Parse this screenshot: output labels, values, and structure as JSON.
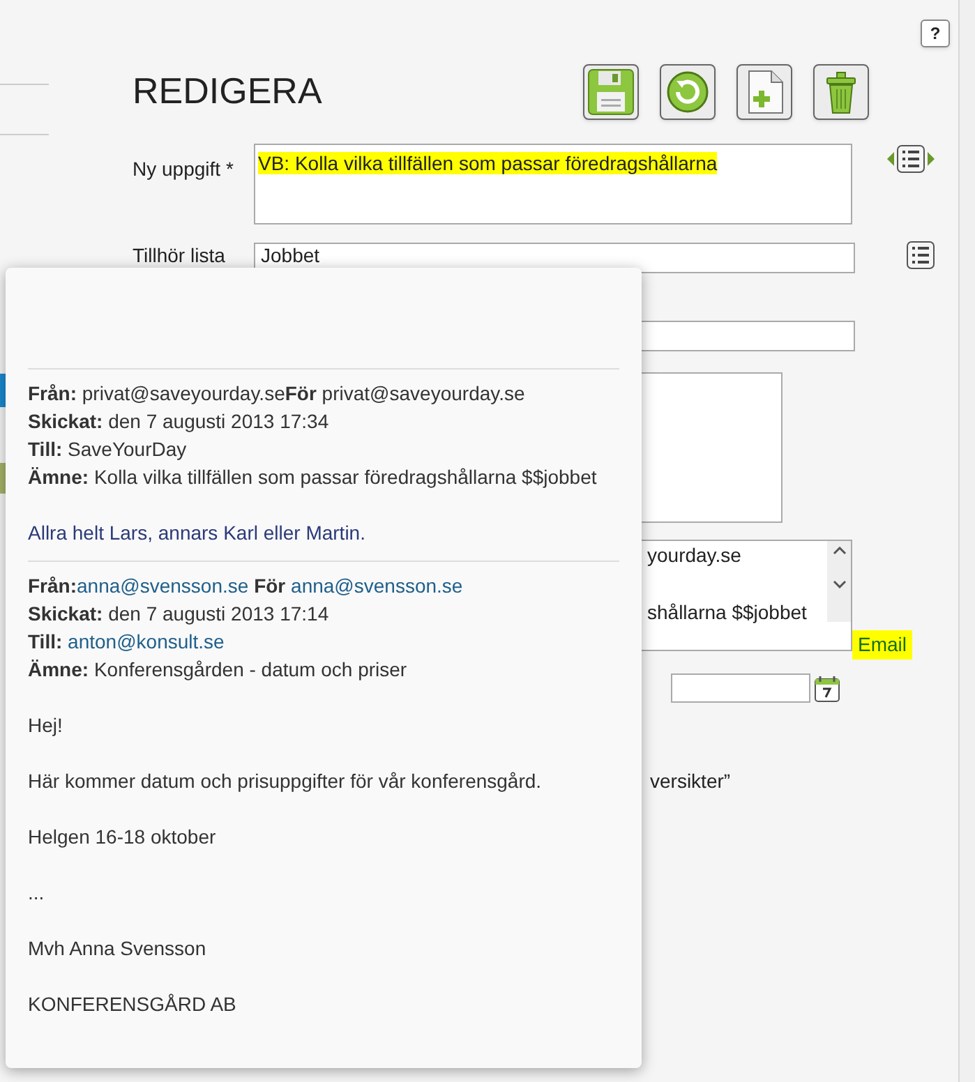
{
  "help_button": "?",
  "title": "REDIGERA",
  "toolbar": [
    {
      "kind": "save"
    },
    {
      "kind": "reset"
    },
    {
      "kind": "new"
    },
    {
      "kind": "delete"
    }
  ],
  "task": {
    "label": "Ny uppgift",
    "required_mark": "*",
    "value": "VB: Kolla vilka tillfällen som passar föredragshållarna",
    "highlighted": true
  },
  "list": {
    "label": "Tillhör lista",
    "value": "Jobbet"
  },
  "notes_preview": {
    "lines": [
      "yourday.se",
      "shållarna $$jobbet"
    ]
  },
  "email_link": {
    "text": "Email",
    "highlighted": true
  },
  "footer_text": "versikter”",
  "popup": {
    "messages": [
      {
        "headers": [
          [
            {
              "text": "Från:",
              "kind": "label"
            },
            {
              "text": " privat@saveyourday.se",
              "kind": "text"
            },
            {
              "text": "För",
              "kind": "label"
            },
            {
              "text": " privat@saveyourday.se",
              "kind": "text"
            }
          ],
          [
            {
              "text": "Skickat:",
              "kind": "label"
            },
            {
              "text": " den 7 augusti 2013 17:34",
              "kind": "text"
            }
          ],
          [
            {
              "text": "Till:",
              "kind": "label"
            },
            {
              "text": " SaveYourDay",
              "kind": "text"
            }
          ],
          [
            {
              "text": "Ämne:",
              "kind": "label"
            },
            {
              "text": " Kolla vilka tillfällen som passar föredragshållarna $$jobbet",
              "kind": "text"
            }
          ]
        ],
        "body": [
          {
            "text": "Allra helt Lars, annars Karl eller Martin.",
            "kind": "quote"
          }
        ]
      },
      {
        "headers": [
          [
            {
              "text": "Från:",
              "kind": "label"
            },
            {
              "text": "anna@svensson.se",
              "kind": "link"
            },
            {
              "text": " För ",
              "kind": "label"
            },
            {
              "text": "anna@svensson.se",
              "kind": "link"
            }
          ],
          [
            {
              "text": "Skickat:",
              "kind": "label"
            },
            {
              "text": " den 7 augusti 2013 17:14",
              "kind": "text"
            }
          ],
          [
            {
              "text": "Till: ",
              "kind": "label"
            },
            {
              "text": "anton@konsult.se",
              "kind": "link"
            }
          ],
          [
            {
              "text": "Ämne:",
              "kind": "label"
            },
            {
              "text": " Konferensgården - datum och priser",
              "kind": "text"
            }
          ]
        ],
        "body": [
          {
            "text": "Hej!",
            "kind": "text"
          },
          {
            "text": "Här kommer datum och prisuppgifter för vår konferensgård.",
            "kind": "text"
          },
          {
            "text": "Helgen 16-18 oktober",
            "kind": "text"
          },
          {
            "text": "...",
            "kind": "text"
          },
          {
            "text": "Mvh Anna Svensson",
            "kind": "text"
          },
          {
            "text": "KONFERENSGÅRD AB",
            "kind": "text"
          }
        ]
      }
    ]
  }
}
